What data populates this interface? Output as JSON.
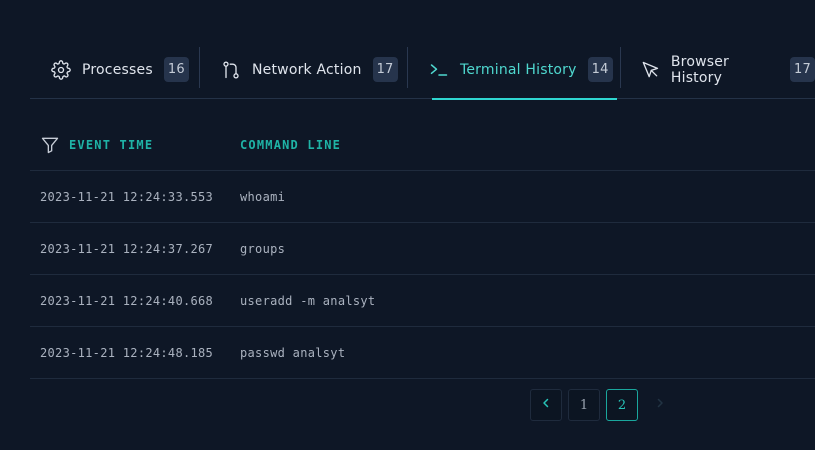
{
  "tabs": [
    {
      "label": "Processes",
      "count": "16",
      "icon": "gear-icon"
    },
    {
      "label": "Network Action",
      "count": "17",
      "icon": "git-pull-icon"
    },
    {
      "label": "Terminal History",
      "count": "14",
      "icon": "terminal-icon",
      "active": true
    },
    {
      "label": "Browser History",
      "count": "17",
      "icon": "cursor-icon"
    }
  ],
  "table": {
    "headers": {
      "event_time": "EVENT TIME",
      "command_line": "COMMAND LINE"
    },
    "rows": [
      {
        "event_time": "2023-11-21 12:24:33.553",
        "command_line": "whoami"
      },
      {
        "event_time": "2023-11-21 12:24:37.267",
        "command_line": "groups"
      },
      {
        "event_time": "2023-11-21 12:24:40.668",
        "command_line": "useradd -m analsyt"
      },
      {
        "event_time": "2023-11-21 12:24:48.185",
        "command_line": "passwd analsyt"
      }
    ]
  },
  "pagination": {
    "pages": [
      "1",
      "2"
    ],
    "current": "2"
  },
  "colors": {
    "accent": "#2fd6d0",
    "header_text": "#1fb3a6",
    "background": "#0e1726",
    "badge_bg": "#26344c"
  }
}
